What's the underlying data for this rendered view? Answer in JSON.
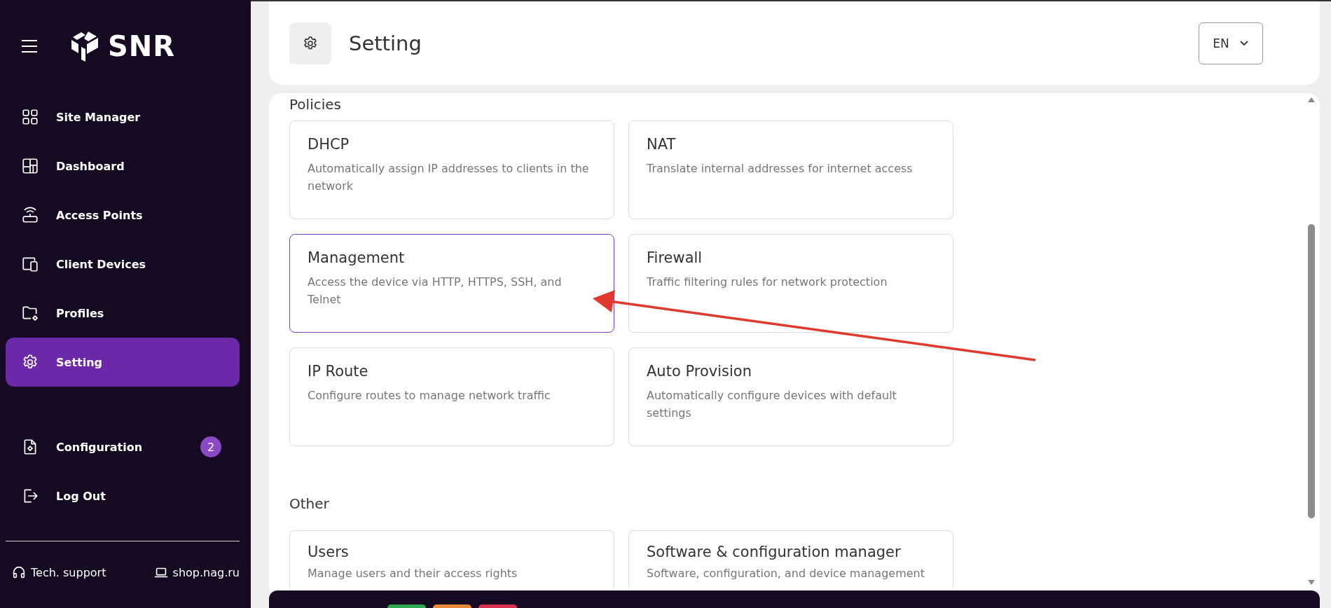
{
  "sidebar": {
    "logo": "SNR",
    "items": [
      {
        "label": "Site Manager",
        "selected": false
      },
      {
        "label": "Dashboard",
        "selected": false
      },
      {
        "label": "Access Points",
        "selected": false
      },
      {
        "label": "Client Devices",
        "selected": false
      },
      {
        "label": "Profiles",
        "selected": false
      },
      {
        "label": "Setting",
        "selected": true
      }
    ],
    "bottom_items": [
      {
        "label": "Configuration",
        "badge": "2"
      },
      {
        "label": "Log Out"
      }
    ],
    "footer": [
      {
        "label": "Tech. support"
      },
      {
        "label": "shop.nag.ru"
      }
    ]
  },
  "header": {
    "title": "Setting",
    "language": "EN"
  },
  "sections": [
    {
      "title": "Policies",
      "cards": [
        {
          "title": "DHCP",
          "description": "Automatically assign IP addresses to clients in the network",
          "selected": false
        },
        {
          "title": "NAT",
          "description": "Translate internal addresses for internet access",
          "selected": false
        },
        {
          "title": "Management",
          "description": "Access the device via HTTP, HTTPS, SSH, and Telnet",
          "selected": true
        },
        {
          "title": "Firewall",
          "description": "Traffic filtering rules for network protection",
          "selected": false
        },
        {
          "title": "IP Route",
          "description": "Configure routes to manage network traffic",
          "selected": false
        },
        {
          "title": "Auto Provision",
          "description": "Automatically configure devices with default settings",
          "selected": false
        }
      ]
    },
    {
      "title": "Other",
      "cards": [
        {
          "title": "Users",
          "description": "Manage users and their access rights",
          "selected": false
        },
        {
          "title": "Software & configuration manager",
          "description": "Software, configuration, and device management",
          "selected": false
        }
      ]
    }
  ],
  "bottom_bar": {
    "buttons": [
      {
        "color": "#2fa84f"
      },
      {
        "color": "#e8893a"
      },
      {
        "color": "#d8304f"
      }
    ]
  }
}
